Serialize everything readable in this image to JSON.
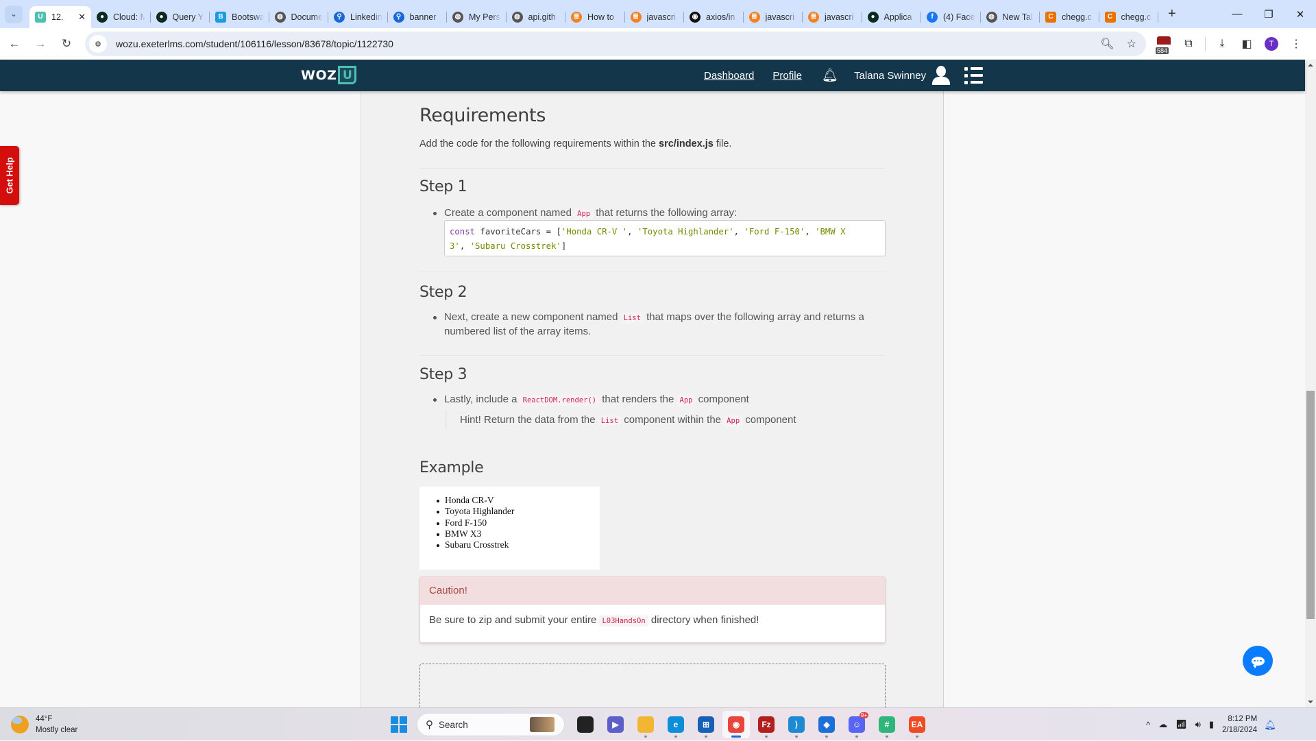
{
  "browser": {
    "tabs": [
      {
        "label": "12.",
        "icon": "wozu-icon",
        "color": "#4cc1b0",
        "active": true
      },
      {
        "label": "Cloud: M",
        "icon": "mongodb-icon",
        "color": "#0b2b1f"
      },
      {
        "label": "Query Y",
        "icon": "mongodb-icon",
        "color": "#0b2b1f"
      },
      {
        "label": "Bootswa",
        "icon": "bootswatch-icon",
        "color": "#1d9be0"
      },
      {
        "label": "Docume",
        "icon": "globe-icon",
        "color": "#555555"
      },
      {
        "label": "Linkedin",
        "icon": "search-icon",
        "color": "#1a68d6"
      },
      {
        "label": "banner",
        "icon": "search-icon",
        "color": "#1a68d6"
      },
      {
        "label": "My Pers",
        "icon": "globe-icon",
        "color": "#555555"
      },
      {
        "label": "api.gith",
        "icon": "globe-icon",
        "color": "#555555"
      },
      {
        "label": "How to",
        "icon": "stackoverflow-icon",
        "color": "#f48024"
      },
      {
        "label": "javascri",
        "icon": "stackoverflow-icon",
        "color": "#f48024"
      },
      {
        "label": "axios/in",
        "icon": "github-icon",
        "color": "#111111"
      },
      {
        "label": "javascri",
        "icon": "stackoverflow-icon",
        "color": "#f48024"
      },
      {
        "label": "javascri",
        "icon": "stackoverflow-icon",
        "color": "#f48024"
      },
      {
        "label": "Applica",
        "icon": "mongodb-icon",
        "color": "#0b2b1f"
      },
      {
        "label": "(4) Face",
        "icon": "facebook-icon",
        "color": "#1877f2"
      },
      {
        "label": "New Tal",
        "icon": "globe-icon",
        "color": "#555555"
      },
      {
        "label": "chegg.c",
        "icon": "chegg-icon",
        "color": "#eb7100"
      },
      {
        "label": "chegg.c",
        "icon": "chegg-icon",
        "color": "#eb7100"
      }
    ],
    "new_tab": "+",
    "url": "wozu.exeterlms.com/student/106116/lesson/83678/topic/1122730",
    "extension_badge": "584",
    "profile_initial": "T"
  },
  "site": {
    "logo_text": "WOZ",
    "logo_letter": "U",
    "nav": {
      "dashboard": "Dashboard",
      "profile": "Profile",
      "user_name": "Talana Swinney"
    },
    "get_help": "Get Help",
    "colors": {
      "navbar": "#13364b",
      "accent": "#4cc1b0",
      "get_help": "#d40d0d",
      "chat": "#0a7cff"
    }
  },
  "lesson": {
    "title": "Requirements",
    "intro_pre": "Add the code for the following requirements within the ",
    "intro_file": "src/index.js",
    "intro_post": " file.",
    "steps": [
      {
        "heading": "Step 1",
        "text_pre": "Create a component named ",
        "code": "App",
        "text_post": " that returns the following array:",
        "codeblock": {
          "keyword": "const",
          "var": " favoriteCars = [",
          "items": [
            "'Honda CR-V '",
            "'Toyota Highlander'",
            "'Ford F-150'",
            "'BMW X 3'",
            "'Subaru Crosstrek'"
          ],
          "line1_str1": "'Honda CR-V '",
          "line1_str2": "'Toyota Highlander'",
          "line1_str3": "'Ford F-150'",
          "line1_str4a": "'BMW X",
          "line2_str4b": "3'",
          "line2_str5": "'Subaru Crosstrek'",
          "sep": ", ",
          "close": "]"
        }
      },
      {
        "heading": "Step 2",
        "text_pre": "Next, create a new component named ",
        "code": "List",
        "text_post": " that maps over the following array and returns a numbered list of the array items."
      },
      {
        "heading": "Step 3",
        "text_pre": "Lastly, include a ",
        "code": "ReactDOM.render()",
        "text_mid": " that renders the ",
        "code2": "App",
        "text_post": " component",
        "hint_pre": "Hint! Return the data from the ",
        "hint_code1": "List",
        "hint_mid": " component within the ",
        "hint_code2": "App",
        "hint_post": " component"
      }
    ],
    "example": {
      "heading": "Example",
      "items": [
        "Honda CR-V",
        "Toyota Highlander",
        "Ford F-150",
        "BMW X3",
        "Subaru Crosstrek"
      ]
    },
    "caution": {
      "title": "Caution!",
      "text_pre": "Be sure to zip and submit your entire ",
      "code": "L03HandsOn",
      "text_post": " directory when finished!"
    }
  },
  "taskbar": {
    "weather_temp": "44°F",
    "weather_desc": "Mostly clear",
    "search_placeholder": "Search",
    "apps": [
      {
        "name": "task-view",
        "color": "#222222",
        "glyph": ""
      },
      {
        "name": "meet",
        "color": "#5b5fc7",
        "glyph": "▶"
      },
      {
        "name": "file-explorer",
        "color": "#f2b632",
        "glyph": ""
      },
      {
        "name": "edge",
        "color": "#0c8fd8",
        "glyph": "e"
      },
      {
        "name": "microsoft-store",
        "color": "#1660b8",
        "glyph": "⊞"
      },
      {
        "name": "chrome",
        "color": "#e8453c",
        "glyph": "◉",
        "active": true
      },
      {
        "name": "filezilla",
        "color": "#b21f1f",
        "glyph": "Fz"
      },
      {
        "name": "vscode",
        "color": "#1f8ad2",
        "glyph": "⟩"
      },
      {
        "name": "azure-data-studio",
        "color": "#1a6fd8",
        "glyph": "◈"
      },
      {
        "name": "discord",
        "color": "#5865f2",
        "glyph": "☺",
        "badge": "9+"
      },
      {
        "name": "slack",
        "color": "#2eb67d",
        "glyph": "#"
      },
      {
        "name": "ea",
        "color": "#ef4b23",
        "glyph": "EA"
      }
    ],
    "time": "8:12 PM",
    "date": "2/18/2024"
  }
}
